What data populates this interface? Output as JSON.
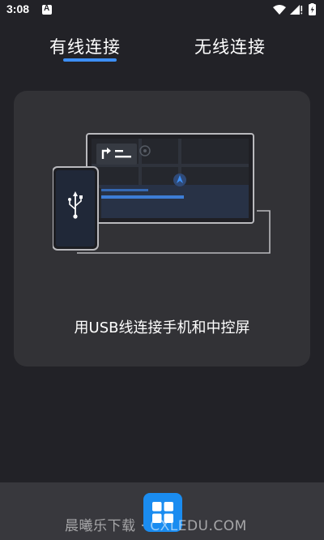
{
  "status_bar": {
    "time": "3:08",
    "icons": [
      "notification-a-icon",
      "wifi-icon",
      "signal-icon",
      "battery-charging-icon"
    ]
  },
  "tabs": [
    {
      "label": "有线连接",
      "selected": true
    },
    {
      "label": "无线连接",
      "selected": false
    }
  ],
  "accent_color": "#3d8ff5",
  "card": {
    "caption": "用USB线连接手机和中控屏",
    "illustration": [
      "phone-usb-icon",
      "car-display-icon",
      "cable"
    ]
  },
  "bottom": {
    "button_icon": "grid-apps-icon",
    "button_color": "#1a8cf0",
    "watermark": "晨曦乐下载 · CXLEDU.COM"
  }
}
